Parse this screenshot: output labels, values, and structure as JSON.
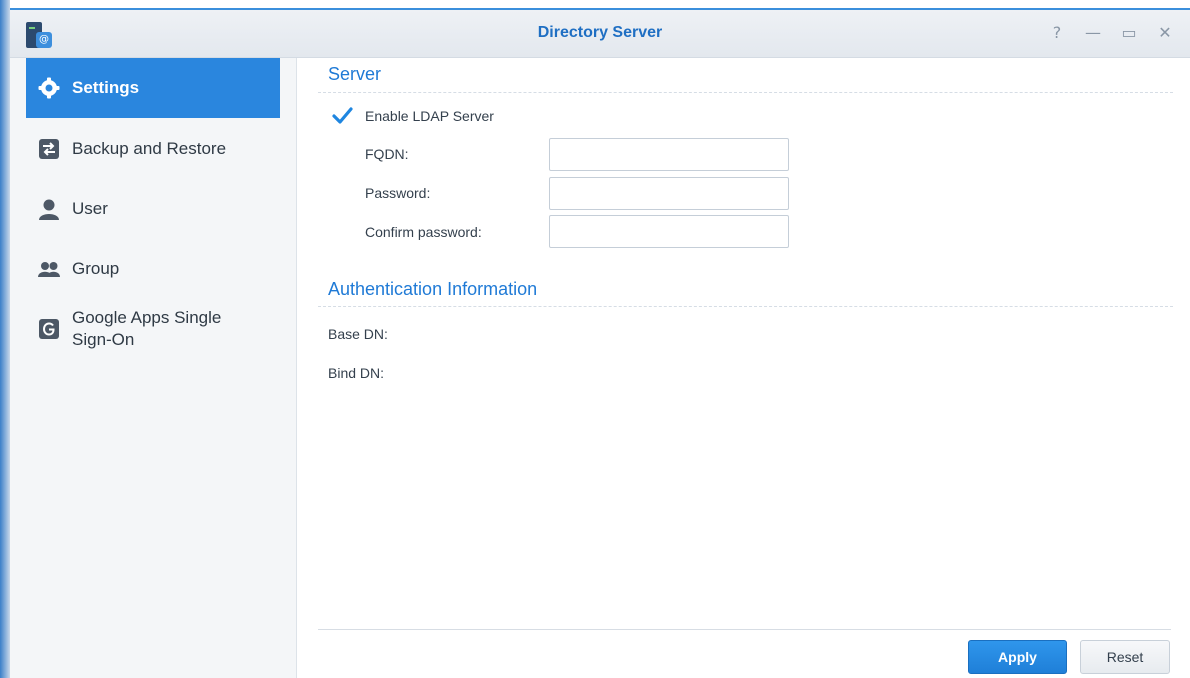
{
  "window": {
    "title": "Directory Server",
    "app_icon": "directory-server-app-icon",
    "app_icon_glyph": "@",
    "controls": [
      {
        "name": "help-icon",
        "glyph": "?"
      },
      {
        "name": "minimize-icon",
        "glyph": "—"
      },
      {
        "name": "maximize-icon",
        "glyph": "▭"
      },
      {
        "name": "close-icon",
        "glyph": "✕"
      }
    ]
  },
  "sidebar": {
    "items": [
      {
        "label": "Settings",
        "icon": "gear-icon",
        "active": true
      },
      {
        "label": "Backup and Restore",
        "icon": "backup-restore-icon",
        "active": false
      },
      {
        "label": "User",
        "icon": "user-icon",
        "active": false
      },
      {
        "label": "Group",
        "icon": "group-icon",
        "active": false
      },
      {
        "label": "Google Apps Single Sign-On",
        "icon": "google-apps-icon",
        "active": false
      }
    ]
  },
  "main": {
    "server_section": {
      "title": "Server",
      "enable_ldap": {
        "label": "Enable LDAP Server",
        "checked": true
      },
      "fqdn": {
        "label": "FQDN:",
        "value": ""
      },
      "password": {
        "label": "Password:",
        "value": ""
      },
      "confirm_password": {
        "label": "Confirm password:",
        "value": ""
      }
    },
    "auth_section": {
      "title": "Authentication Information",
      "base_dn": {
        "label": "Base DN:"
      },
      "bind_dn": {
        "label": "Bind DN:"
      }
    },
    "buttons": {
      "apply": "Apply",
      "reset": "Reset"
    }
  },
  "colors": {
    "accent": "#2a86de",
    "title_text": "#1f6fc3",
    "sidebar_bg": "#f4f6f8"
  }
}
